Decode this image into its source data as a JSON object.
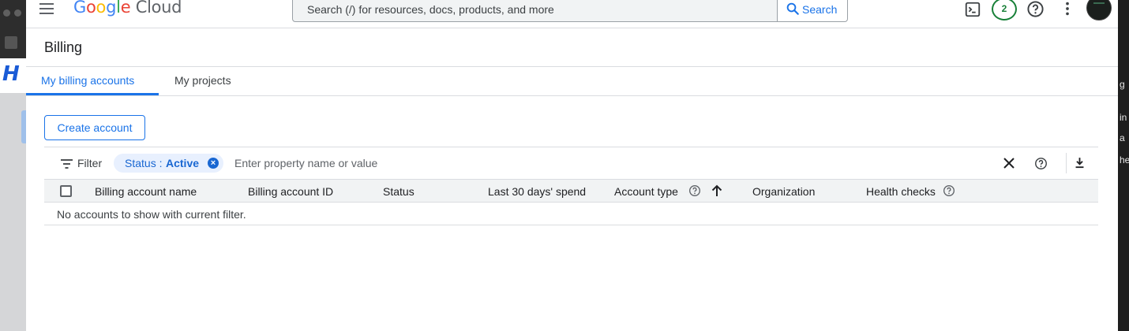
{
  "topbar": {
    "logo_google": [
      "G",
      "o",
      "o",
      "g",
      "l",
      "e"
    ],
    "logo_cloud": "Cloud",
    "search_placeholder": "Search (/) for resources, docs, products, and more",
    "search_button": "Search",
    "notification_count": "2"
  },
  "page": {
    "title": "Billing"
  },
  "tabs": [
    {
      "label": "My billing accounts",
      "active": true
    },
    {
      "label": "My projects",
      "active": false
    }
  ],
  "actions": {
    "create_account": "Create account"
  },
  "filter": {
    "label": "Filter",
    "chip_key": "Status : ",
    "chip_value": "Active",
    "input_placeholder": "Enter property name or value"
  },
  "table": {
    "columns": [
      "Billing account name",
      "Billing account ID",
      "Status",
      "Last 30 days' spend",
      "Account type",
      "Organization",
      "Health checks"
    ],
    "empty_message": "No accounts to show with current filter."
  },
  "colors": {
    "accent": "#1a73e8",
    "badge_green": "#188038"
  },
  "icons": [
    "menu-icon",
    "search-icon",
    "cloud-shell-icon",
    "help-icon",
    "more-vert-icon",
    "avatar",
    "filter-icon",
    "chip-close-icon",
    "clear-icon",
    "download-icon",
    "sort-arrow-up-icon"
  ]
}
